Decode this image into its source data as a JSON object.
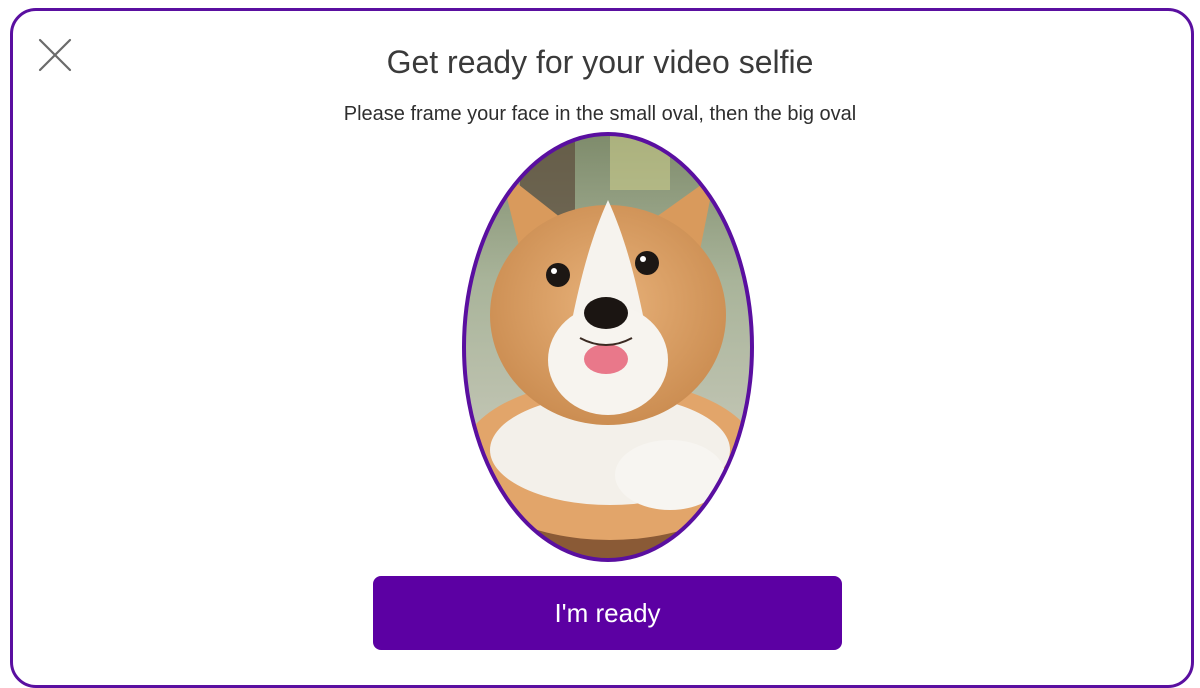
{
  "dialog": {
    "title": "Get ready for your video selfie",
    "subtitle": "Please frame your face in the small oval, then the big oval",
    "close_icon": "close-icon",
    "primary_button_label": "I'm ready"
  },
  "preview": {
    "subject": "corgi-puppy-photo",
    "frame_shape": "oval"
  },
  "colors": {
    "accent": "#5c00a3",
    "frame_border": "#5a0fa0",
    "text": "#333333",
    "background": "#ffffff"
  }
}
